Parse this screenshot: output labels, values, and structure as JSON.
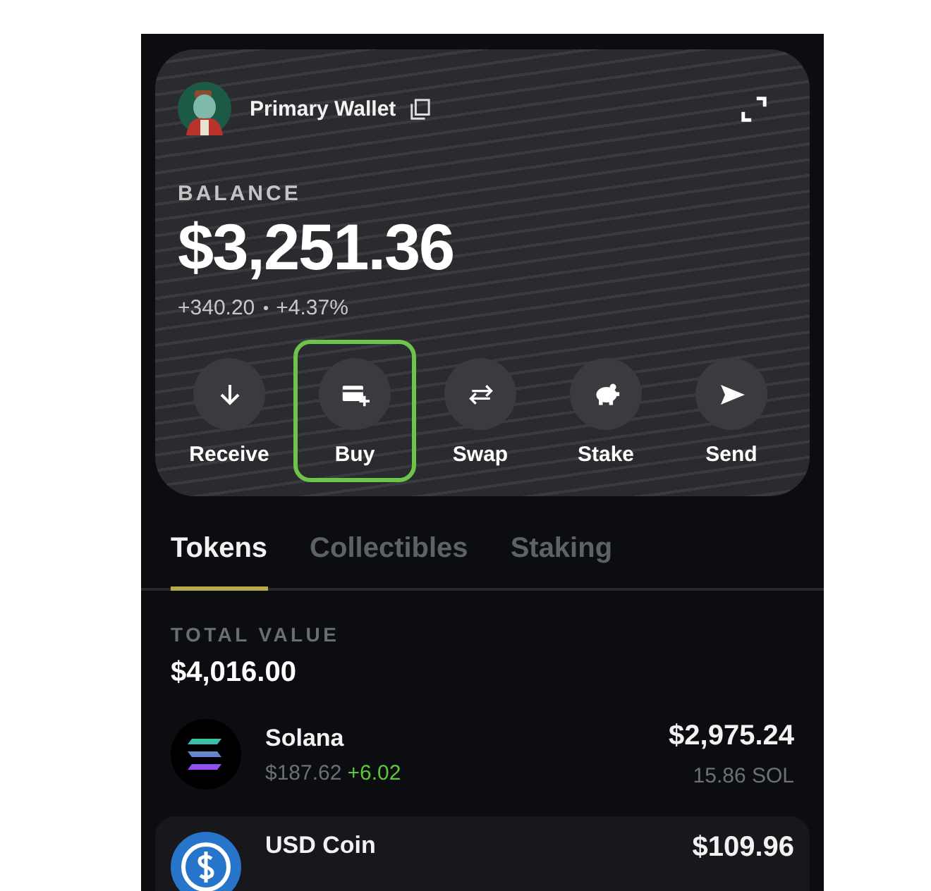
{
  "wallet": {
    "name": "Primary Wallet"
  },
  "balance": {
    "label": "BALANCE",
    "amount": "$3,251.36",
    "change": "+340.20",
    "percent": "+4.37%"
  },
  "actions": [
    {
      "label": "Receive",
      "kind": "receive",
      "selected": false
    },
    {
      "label": "Buy",
      "kind": "buy",
      "selected": true
    },
    {
      "label": "Swap",
      "kind": "swap",
      "selected": false
    },
    {
      "label": "Stake",
      "kind": "stake",
      "selected": false
    },
    {
      "label": "Send",
      "kind": "send",
      "selected": false
    }
  ],
  "tabs": [
    {
      "label": "Tokens",
      "selected": true
    },
    {
      "label": "Collectibles",
      "selected": false
    },
    {
      "label": "Staking",
      "selected": false
    }
  ],
  "total": {
    "label": "TOTAL VALUE",
    "value": "$4,016.00"
  },
  "tokens": [
    {
      "name": "Solana",
      "kind": "solana",
      "price": "$187.62",
      "change": "+6.02",
      "value": "$2,975.24",
      "amount": "15.86 SOL",
      "selected": false
    },
    {
      "name": "USD Coin",
      "kind": "usdc",
      "value": "$109.96",
      "selected": true
    }
  ]
}
